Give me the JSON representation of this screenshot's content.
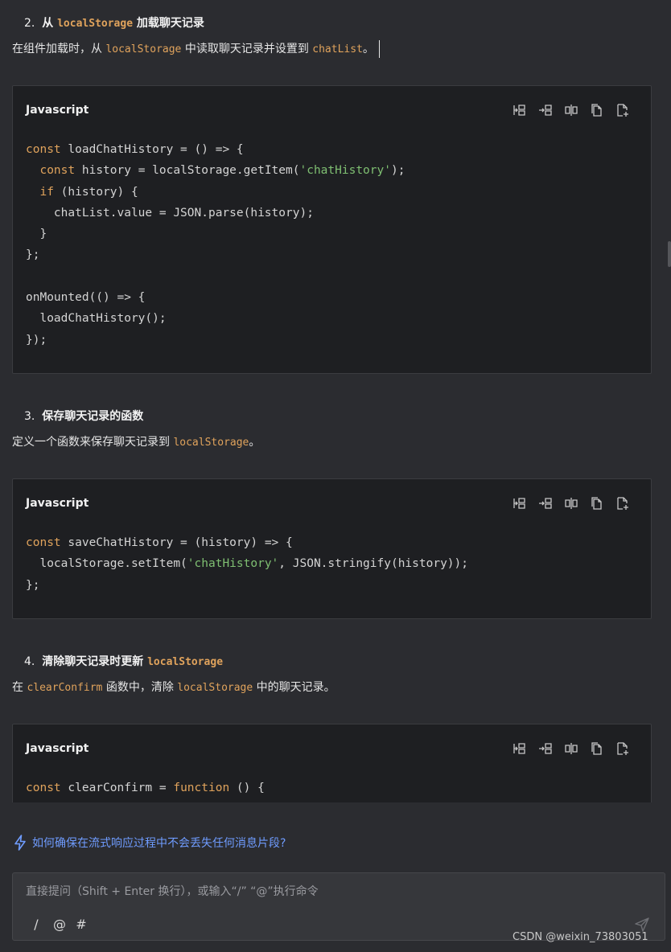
{
  "sections": [
    {
      "num": "2.",
      "title": "从",
      "code": "localStorage",
      "title_after": "加载聊天记录",
      "desc": [
        {
          "t": "在组件加载时，从 "
        },
        {
          "c": "localStorage"
        },
        {
          "t": " 中读取聊天记录并设置到 "
        },
        {
          "c": "chatList"
        },
        {
          "t": "。"
        }
      ]
    },
    {
      "num": "3.",
      "title": "保存聊天记录的函数",
      "desc": [
        {
          "t": "定义一个函数来保存聊天记录到 "
        },
        {
          "c": "localStorage"
        },
        {
          "t": "。"
        }
      ]
    },
    {
      "num": "4.",
      "title": "清除聊天记录时更新",
      "code": "localStorage",
      "desc": [
        {
          "t": "在 "
        },
        {
          "c": "clearConfirm"
        },
        {
          "t": " 函数中，清除 "
        },
        {
          "c": "localStorage"
        },
        {
          "t": " 中的聊天记录。"
        }
      ]
    }
  ],
  "code_blocks": [
    {
      "lang": "Javascript",
      "lines": [
        [
          {
            "k": "const"
          },
          {
            "p": " loadChatHistory = () => {"
          }
        ],
        [
          {
            "p": "  "
          },
          {
            "k": "const"
          },
          {
            "p": " history = localStorage.getItem("
          },
          {
            "s": "'chatHistory'"
          },
          {
            "p": ");"
          }
        ],
        [
          {
            "p": "  "
          },
          {
            "k": "if"
          },
          {
            "p": " (history) {"
          }
        ],
        [
          {
            "p": "    chatList.value = JSON.parse(history);"
          }
        ],
        [
          {
            "p": "  }"
          }
        ],
        [
          {
            "p": "};"
          }
        ],
        [
          {
            "p": ""
          }
        ],
        [
          {
            "p": "onMounted(() => {"
          }
        ],
        [
          {
            "p": "  loadChatHistory();"
          }
        ],
        [
          {
            "p": "});"
          }
        ]
      ]
    },
    {
      "lang": "Javascript",
      "lines": [
        [
          {
            "k": "const"
          },
          {
            "p": " saveChatHistory = (history) => {"
          }
        ],
        [
          {
            "p": "  localStorage.setItem("
          },
          {
            "s": "'chatHistory'"
          },
          {
            "p": ", JSON.stringify(history));"
          }
        ],
        [
          {
            "p": "};"
          }
        ]
      ]
    },
    {
      "lang": "Javascript",
      "lines": [
        [
          {
            "k": "const"
          },
          {
            "p": " clearConfirm = "
          },
          {
            "k": "function"
          },
          {
            "p": " () {"
          }
        ]
      ]
    }
  ],
  "toolbar_icons": [
    "insert-left-icon",
    "insert-right-icon",
    "split-icon",
    "copy-icon",
    "new-file-icon"
  ],
  "suggestion": "如何确保在流式响应过程中不会丢失任何消息片段?",
  "input": {
    "placeholder": "直接提问（Shift + Enter 换行），或输入“/” “@”执行命令",
    "tools": [
      "/",
      "@",
      "#"
    ]
  },
  "watermark": "CSDN @weixin_73803051",
  "colors": {
    "background": "#2b2c30",
    "code_bg": "#1e1f22",
    "keyword": "#e0a35c",
    "string": "#7fbf72",
    "link": "#6f9cff"
  }
}
